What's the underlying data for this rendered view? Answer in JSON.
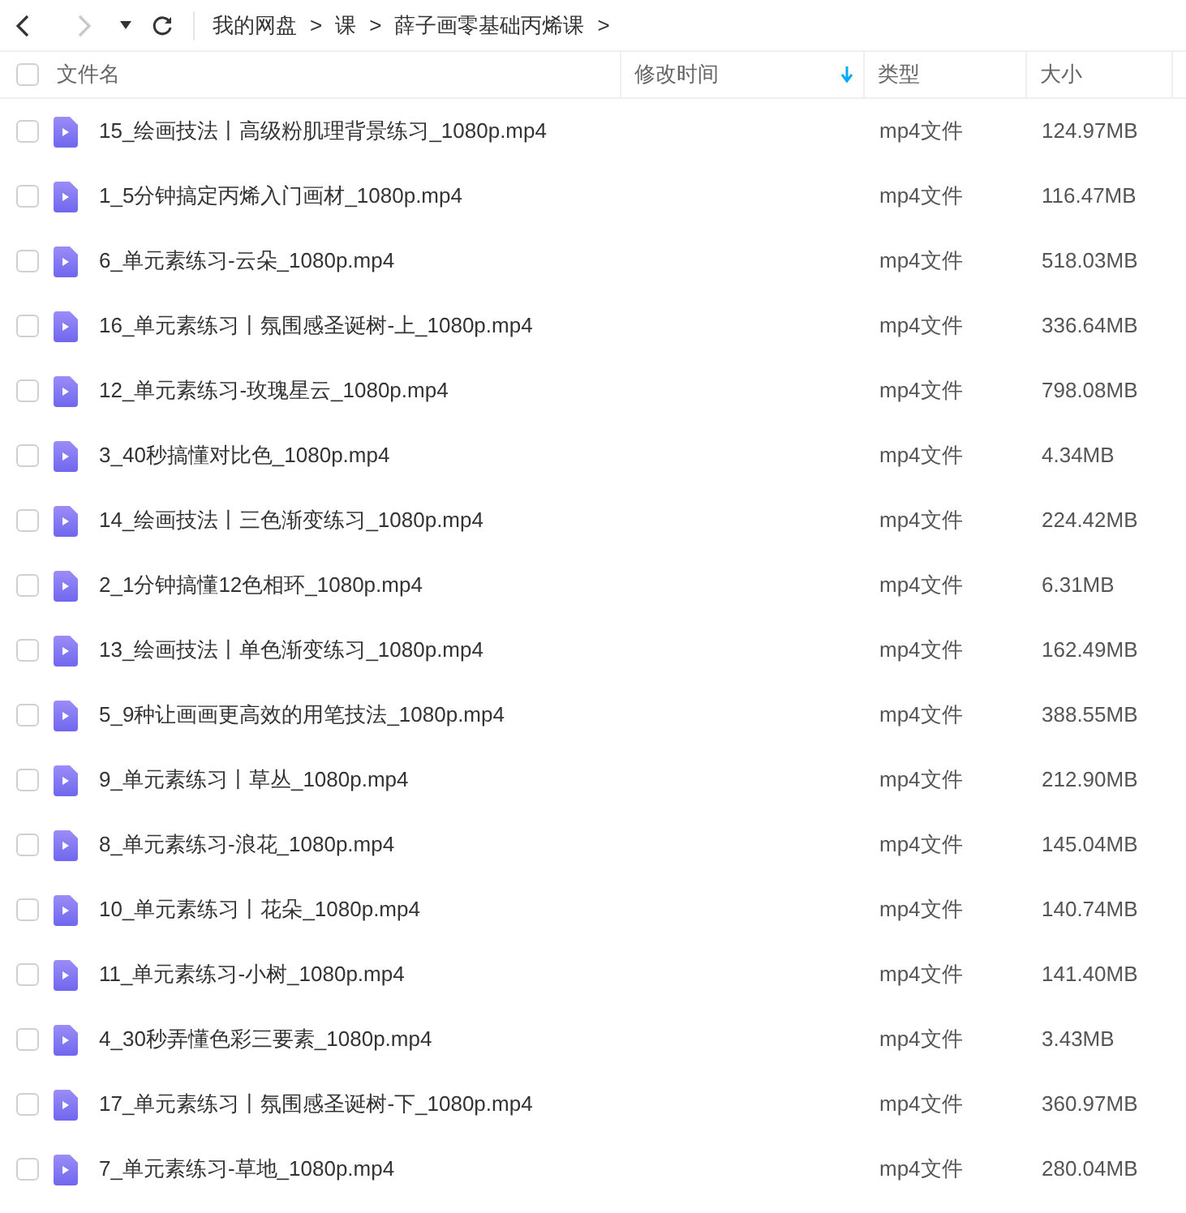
{
  "nav": {
    "back": {
      "disabled": false
    },
    "forward": {
      "disabled": true
    }
  },
  "breadcrumb": [
    {
      "label": "我的网盘",
      "separator": ">"
    },
    {
      "label": "课",
      "separator": ">"
    },
    {
      "label": "薛子画零基础丙烯课",
      "separator": ">"
    }
  ],
  "table": {
    "select_all": {
      "checked": false
    },
    "columns": [
      {
        "label": "文件名",
        "sorted": false
      },
      {
        "label": "修改时间",
        "sorted": true
      },
      {
        "label": "类型",
        "sorted": false
      },
      {
        "label": "大小",
        "sorted": false
      }
    ],
    "rows": [
      {
        "name": "15_绘画技法丨高级粉肌理背景练习_1080p.mp4",
        "type": "mp4文件",
        "size": "124.97MB",
        "checked": false
      },
      {
        "name": "1_5分钟搞定丙烯入门画材_1080p.mp4",
        "type": "mp4文件",
        "size": "116.47MB",
        "checked": false
      },
      {
        "name": "6_单元素练习-云朵_1080p.mp4",
        "type": "mp4文件",
        "size": "518.03MB",
        "checked": false
      },
      {
        "name": "16_单元素练习丨氛围感圣诞树-上_1080p.mp4",
        "type": "mp4文件",
        "size": "336.64MB",
        "checked": false
      },
      {
        "name": "12_单元素练习-玫瑰星云_1080p.mp4",
        "type": "mp4文件",
        "size": "798.08MB",
        "checked": false
      },
      {
        "name": "3_40秒搞懂对比色_1080p.mp4",
        "type": "mp4文件",
        "size": "4.34MB",
        "checked": false
      },
      {
        "name": "14_绘画技法丨三色渐变练习_1080p.mp4",
        "type": "mp4文件",
        "size": "224.42MB",
        "checked": false
      },
      {
        "name": "2_1分钟搞懂12色相环_1080p.mp4",
        "type": "mp4文件",
        "size": "6.31MB",
        "checked": false
      },
      {
        "name": "13_绘画技法丨单色渐变练习_1080p.mp4",
        "type": "mp4文件",
        "size": "162.49MB",
        "checked": false
      },
      {
        "name": "5_9种让画画更高效的用笔技法_1080p.mp4",
        "type": "mp4文件",
        "size": "388.55MB",
        "checked": false
      },
      {
        "name": "9_单元素练习丨草丛_1080p.mp4",
        "type": "mp4文件",
        "size": "212.90MB",
        "checked": false
      },
      {
        "name": "8_单元素练习-浪花_1080p.mp4",
        "type": "mp4文件",
        "size": "145.04MB",
        "checked": false
      },
      {
        "name": "10_单元素练习丨花朵_1080p.mp4",
        "type": "mp4文件",
        "size": "140.74MB",
        "checked": false
      },
      {
        "name": "11_单元素练习-小树_1080p.mp4",
        "type": "mp4文件",
        "size": "141.40MB",
        "checked": false
      },
      {
        "name": "4_30秒弄懂色彩三要素_1080p.mp4",
        "type": "mp4文件",
        "size": "3.43MB",
        "checked": false
      },
      {
        "name": "17_单元素练习丨氛围感圣诞树-下_1080p.mp4",
        "type": "mp4文件",
        "size": "360.97MB",
        "checked": false
      },
      {
        "name": "7_单元素练习-草地_1080p.mp4",
        "type": "mp4文件",
        "size": "280.04MB",
        "checked": false
      }
    ]
  }
}
